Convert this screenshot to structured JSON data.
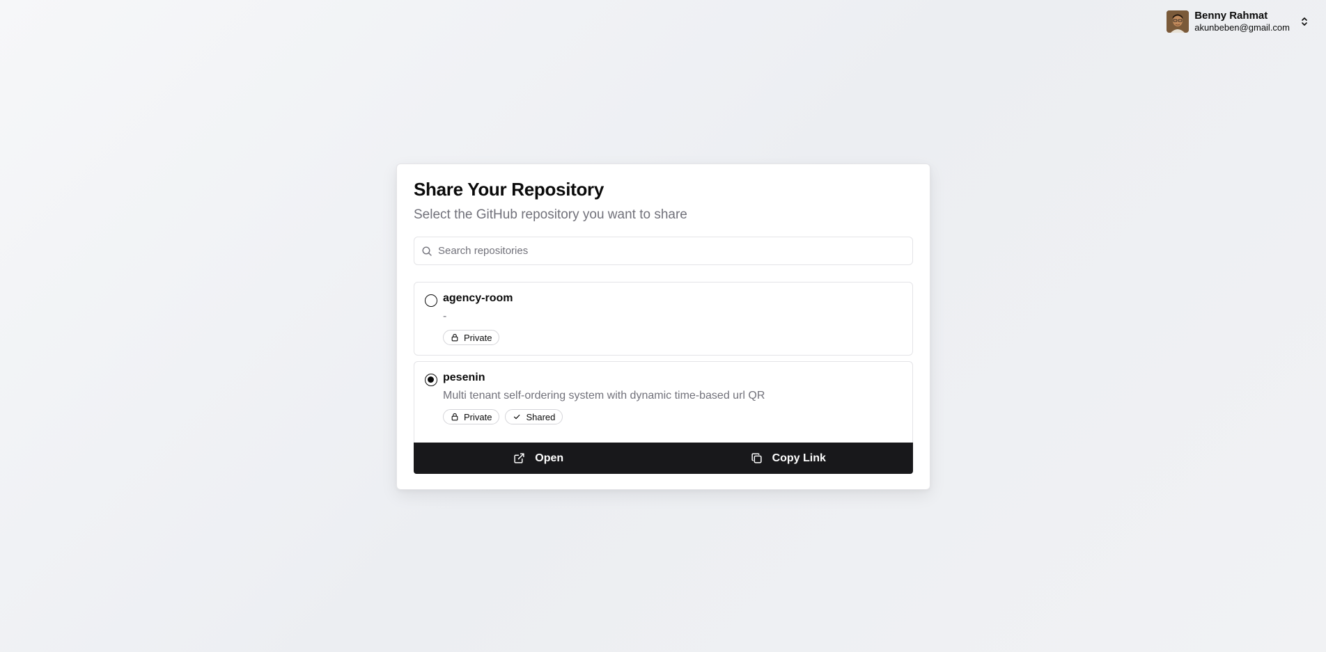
{
  "user": {
    "name": "Benny Rahmat",
    "email": "akunbeben@gmail.com"
  },
  "card": {
    "title": "Share Your Repository",
    "subtitle": "Select the GitHub repository you want to share"
  },
  "search": {
    "placeholder": "Search repositories",
    "value": ""
  },
  "repositories": [
    {
      "name": "agency-room",
      "description": "-",
      "selected": false,
      "badges": [
        {
          "label": "Private",
          "icon": "lock-icon"
        }
      ]
    },
    {
      "name": "pesenin",
      "description": "Multi tenant self-ordering system with dynamic time-based url QR",
      "selected": true,
      "badges": [
        {
          "label": "Private",
          "icon": "lock-icon"
        },
        {
          "label": "Shared",
          "icon": "check-icon"
        }
      ]
    }
  ],
  "actions": {
    "open_label": "Open",
    "copy_label": "Copy Link"
  },
  "colors": {
    "accent": "#18181b",
    "muted_text": "#71717a",
    "border": "#e4e4e7"
  }
}
